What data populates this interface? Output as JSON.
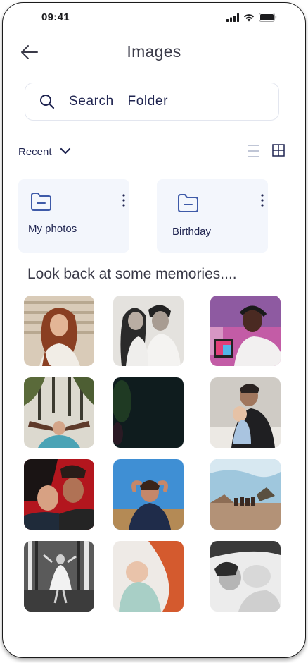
{
  "status_bar": {
    "time": "09:41"
  },
  "header": {
    "title": "Images"
  },
  "search": {
    "placeholder": "Search  Folder"
  },
  "sort": {
    "label": "Recent"
  },
  "folders": [
    {
      "name": "My photos"
    },
    {
      "name": "Birthday"
    }
  ],
  "memories": {
    "title": "Look back at some memories...."
  },
  "photos": [
    {
      "subject": "woman with curly hair against brick wall"
    },
    {
      "subject": "smiling couple black and white"
    },
    {
      "subject": "man with headphones at laptop"
    },
    {
      "subject": "woman reaching up among trees"
    },
    {
      "subject": "dark abstract image"
    },
    {
      "subject": "father holding baby"
    },
    {
      "subject": "couple lying upside down smiling"
    },
    {
      "subject": "child under blue sky"
    },
    {
      "subject": "camels in desert landscape"
    },
    {
      "subject": "girl dancing in forest black and white"
    },
    {
      "subject": "sleeping newborn baby"
    },
    {
      "subject": "mother with baby black and white"
    }
  ],
  "colors": {
    "accent": "#1f2450",
    "folder_bg": "#f3f6fc",
    "icon_blue": "#3e5aa8"
  }
}
